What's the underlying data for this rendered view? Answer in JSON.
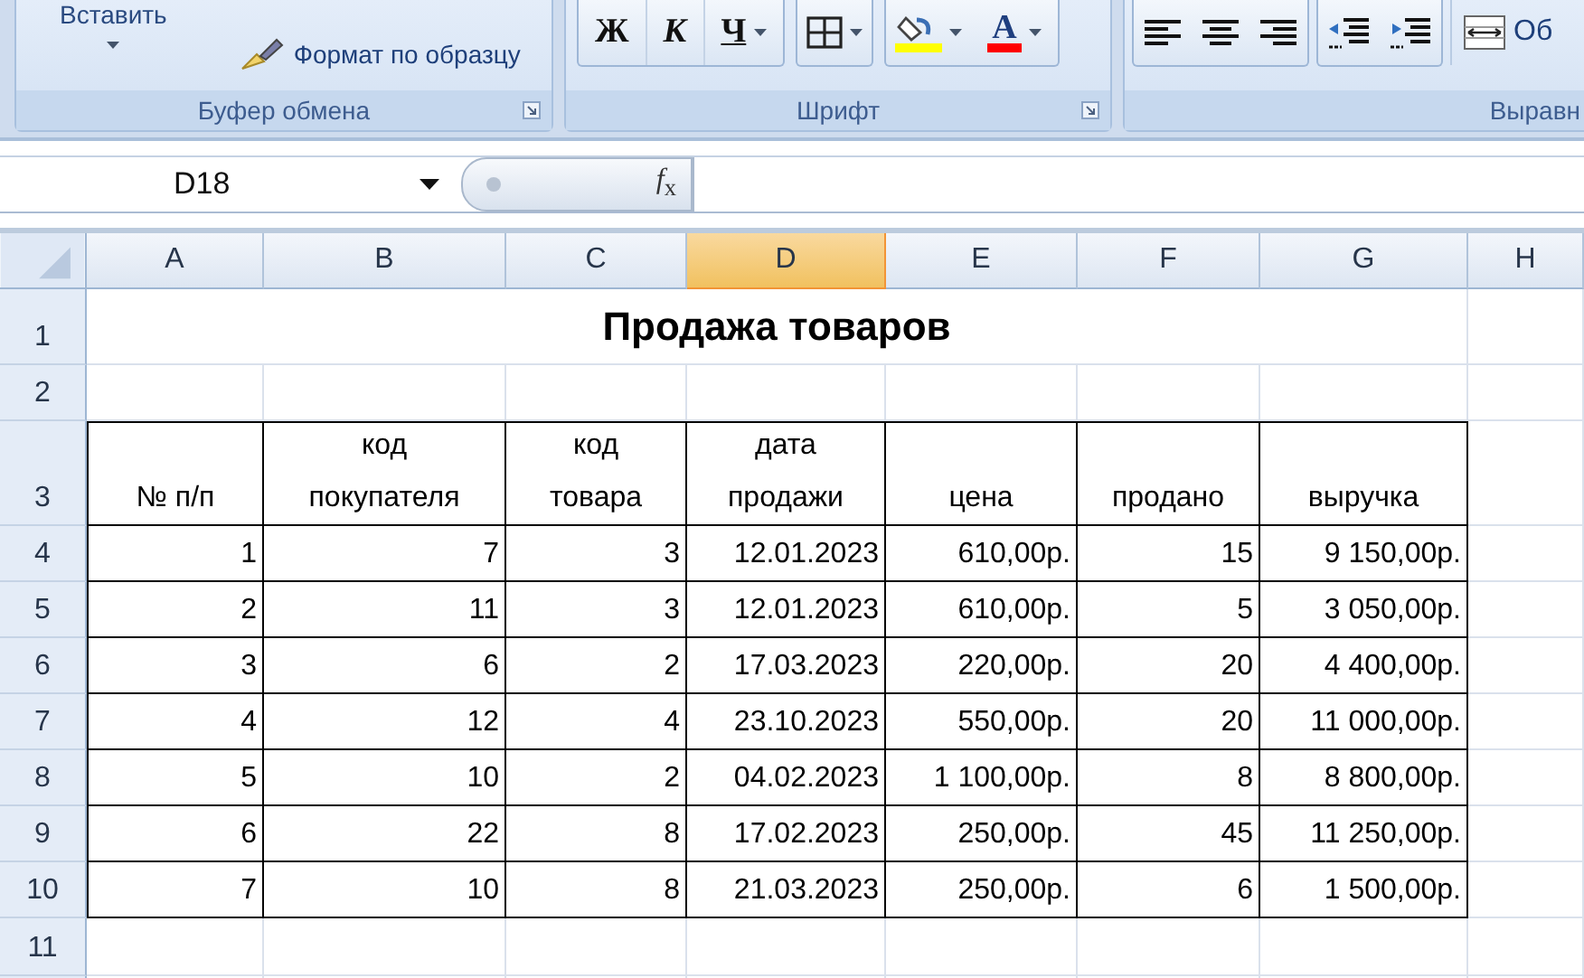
{
  "ribbon": {
    "groups": [
      {
        "kind": "clipboard",
        "label": "Буфер обмена",
        "launcher": true,
        "segments": [
          [
            {
              "kind": "paste",
              "text": "Вставить",
              "dropdown": true
            }
          ],
          [
            {
              "kind": "format_painter",
              "text": "Формат по образцу",
              "dropdown": false
            }
          ]
        ]
      },
      {
        "kind": "toolbar",
        "label": "Шрифт",
        "launcher": true,
        "segments": [
          [
            {
              "kind": "bold",
              "text": "Ж",
              "dropdown": false
            },
            {
              "kind": "italic",
              "text": "К",
              "dropdown": false
            },
            {
              "kind": "underline",
              "text": "Ч",
              "dropdown": true
            }
          ],
          [
            {
              "kind": "borders",
              "dropdown": true
            }
          ],
          [
            {
              "kind": "fill_color",
              "dropdown": true
            },
            {
              "kind": "font_color",
              "text": "А",
              "dropdown": true
            }
          ]
        ]
      },
      {
        "kind": "toolbar",
        "label": "Выравн",
        "launcher": false,
        "segments": [
          [
            {
              "kind": "align_left",
              "dropdown": false
            },
            {
              "kind": "align_center",
              "dropdown": false
            },
            {
              "kind": "align_right",
              "dropdown": false
            }
          ],
          [
            {
              "kind": "outdent",
              "dropdown": false
            },
            {
              "kind": "indent",
              "dropdown": false
            }
          ],
          [
            {
              "kind": "merge",
              "text": "Об",
              "dropdown": false
            }
          ]
        ]
      }
    ]
  },
  "formula_bar": {
    "name_box": "D18",
    "function_button": "*f*$_{x}$"
  },
  "columns": [
    {
      "label": "A",
      "selected": false
    },
    {
      "label": "B",
      "selected": false
    },
    {
      "label": "C",
      "selected": false
    },
    {
      "label": "D",
      "selected": true
    },
    {
      "label": "E",
      "selected": false
    },
    {
      "label": "F",
      "selected": false
    },
    {
      "label": "G",
      "selected": false
    },
    {
      "label": "H",
      "selected": false
    }
  ],
  "rows": [
    {
      "number": "1",
      "kind": "title",
      "text": "Продажа товаров"
    },
    {
      "number": "2",
      "kind": "empty"
    },
    {
      "number": "3",
      "kind": "header",
      "cells": [
        "№ п/п",
        "код\nпокупателя",
        "код\nтовара",
        "дата\nпродажи",
        "цена",
        "продано",
        "выручка"
      ]
    },
    {
      "number": "4",
      "kind": "data",
      "cells": [
        "1",
        "7",
        "3",
        "12.01.2023",
        "610,00р.",
        "15",
        "9 150,00р."
      ]
    },
    {
      "number": "5",
      "kind": "data",
      "cells": [
        "2",
        "11",
        "3",
        "12.01.2023",
        "610,00р.",
        "5",
        "3 050,00р."
      ]
    },
    {
      "number": "6",
      "kind": "data",
      "cells": [
        "3",
        "6",
        "2",
        "17.03.2023",
        "220,00р.",
        "20",
        "4 400,00р."
      ]
    },
    {
      "number": "7",
      "kind": "data",
      "cells": [
        "4",
        "12",
        "4",
        "23.10.2023",
        "550,00р.",
        "20",
        "11 000,00р."
      ]
    },
    {
      "number": "8",
      "kind": "data",
      "cells": [
        "5",
        "10",
        "2",
        "04.02.2023",
        "1 100,00р.",
        "8",
        "8 800,00р."
      ]
    },
    {
      "number": "9",
      "kind": "data",
      "cells": [
        "6",
        "22",
        "8",
        "17.02.2023",
        "250,00р.",
        "45",
        "11 250,00р."
      ]
    },
    {
      "number": "10",
      "kind": "data",
      "cells": [
        "7",
        "10",
        "8",
        "21.03.2023",
        "250,00р.",
        "6",
        "1 500,00р."
      ]
    },
    {
      "number": "11",
      "kind": "empty"
    }
  ]
}
